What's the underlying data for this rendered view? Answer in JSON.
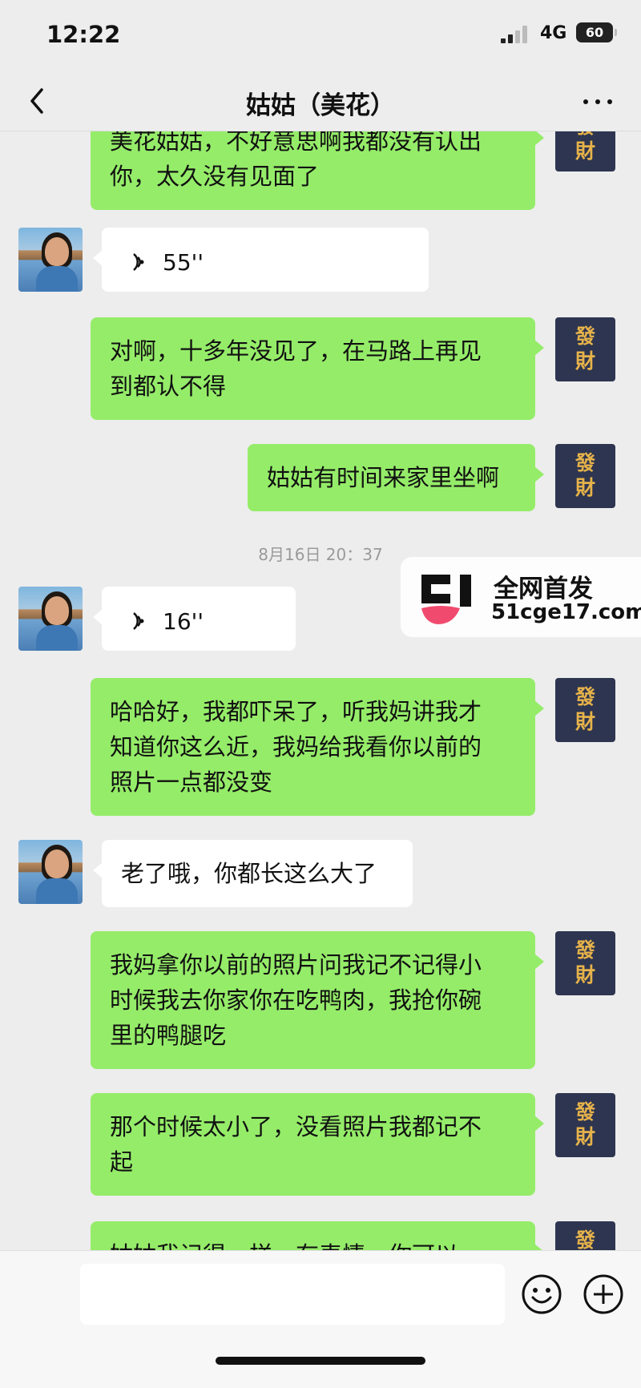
{
  "status_bar": {
    "time": "12:22",
    "network": "4G",
    "battery": "60"
  },
  "nav": {
    "title": "姑姑（美花）",
    "back_icon": "chevron-left-icon",
    "more_icon": "more-dots-icon"
  },
  "self_avatar": {
    "line1": "發",
    "line2": "財"
  },
  "messages": [
    {
      "from": "me",
      "type": "text",
      "lines": [
        "美花姑姑，不好意思啊我都没有认出",
        "你，太久没有见面了"
      ]
    },
    {
      "from": "other",
      "type": "voice",
      "duration": "55''"
    },
    {
      "from": "me",
      "type": "text",
      "lines": [
        "对啊，十多年没见了，在马路上再见",
        "到都认不得"
      ]
    },
    {
      "from": "me",
      "type": "text",
      "lines": [
        "姑姑有时间来家里坐啊"
      ]
    },
    {
      "from": "system",
      "type": "timestamp",
      "text": "8月16日 20：37"
    },
    {
      "from": "other",
      "type": "voice",
      "duration": "16''"
    },
    {
      "from": "me",
      "type": "text",
      "lines": [
        "哈哈好，我都吓呆了，听我妈讲我才",
        "知道你这么近，我妈给我看你以前的",
        "照片一点都没变"
      ]
    },
    {
      "from": "other",
      "type": "text",
      "lines": [
        "老了哦，你都长这么大了"
      ]
    },
    {
      "from": "me",
      "type": "text",
      "lines": [
        "我妈拿你以前的照片问我记不记得小",
        "时候我去你家你在吃鸭肉，我抢你碗",
        "里的鸭腿吃"
      ]
    },
    {
      "from": "me",
      "type": "text",
      "lines": [
        "那个时候太小了，没看照片我都记不",
        "起"
      ]
    },
    {
      "from": "me",
      "type": "text",
      "lines": [
        "姑姑我记得一样，有表情，你可以"
      ]
    }
  ],
  "watermark": {
    "title": "全网首发",
    "site": "51cge17.com"
  },
  "input_bar": {
    "placeholder": "",
    "emoji_icon": "emoji-icon",
    "plus_icon": "plus-icon"
  }
}
